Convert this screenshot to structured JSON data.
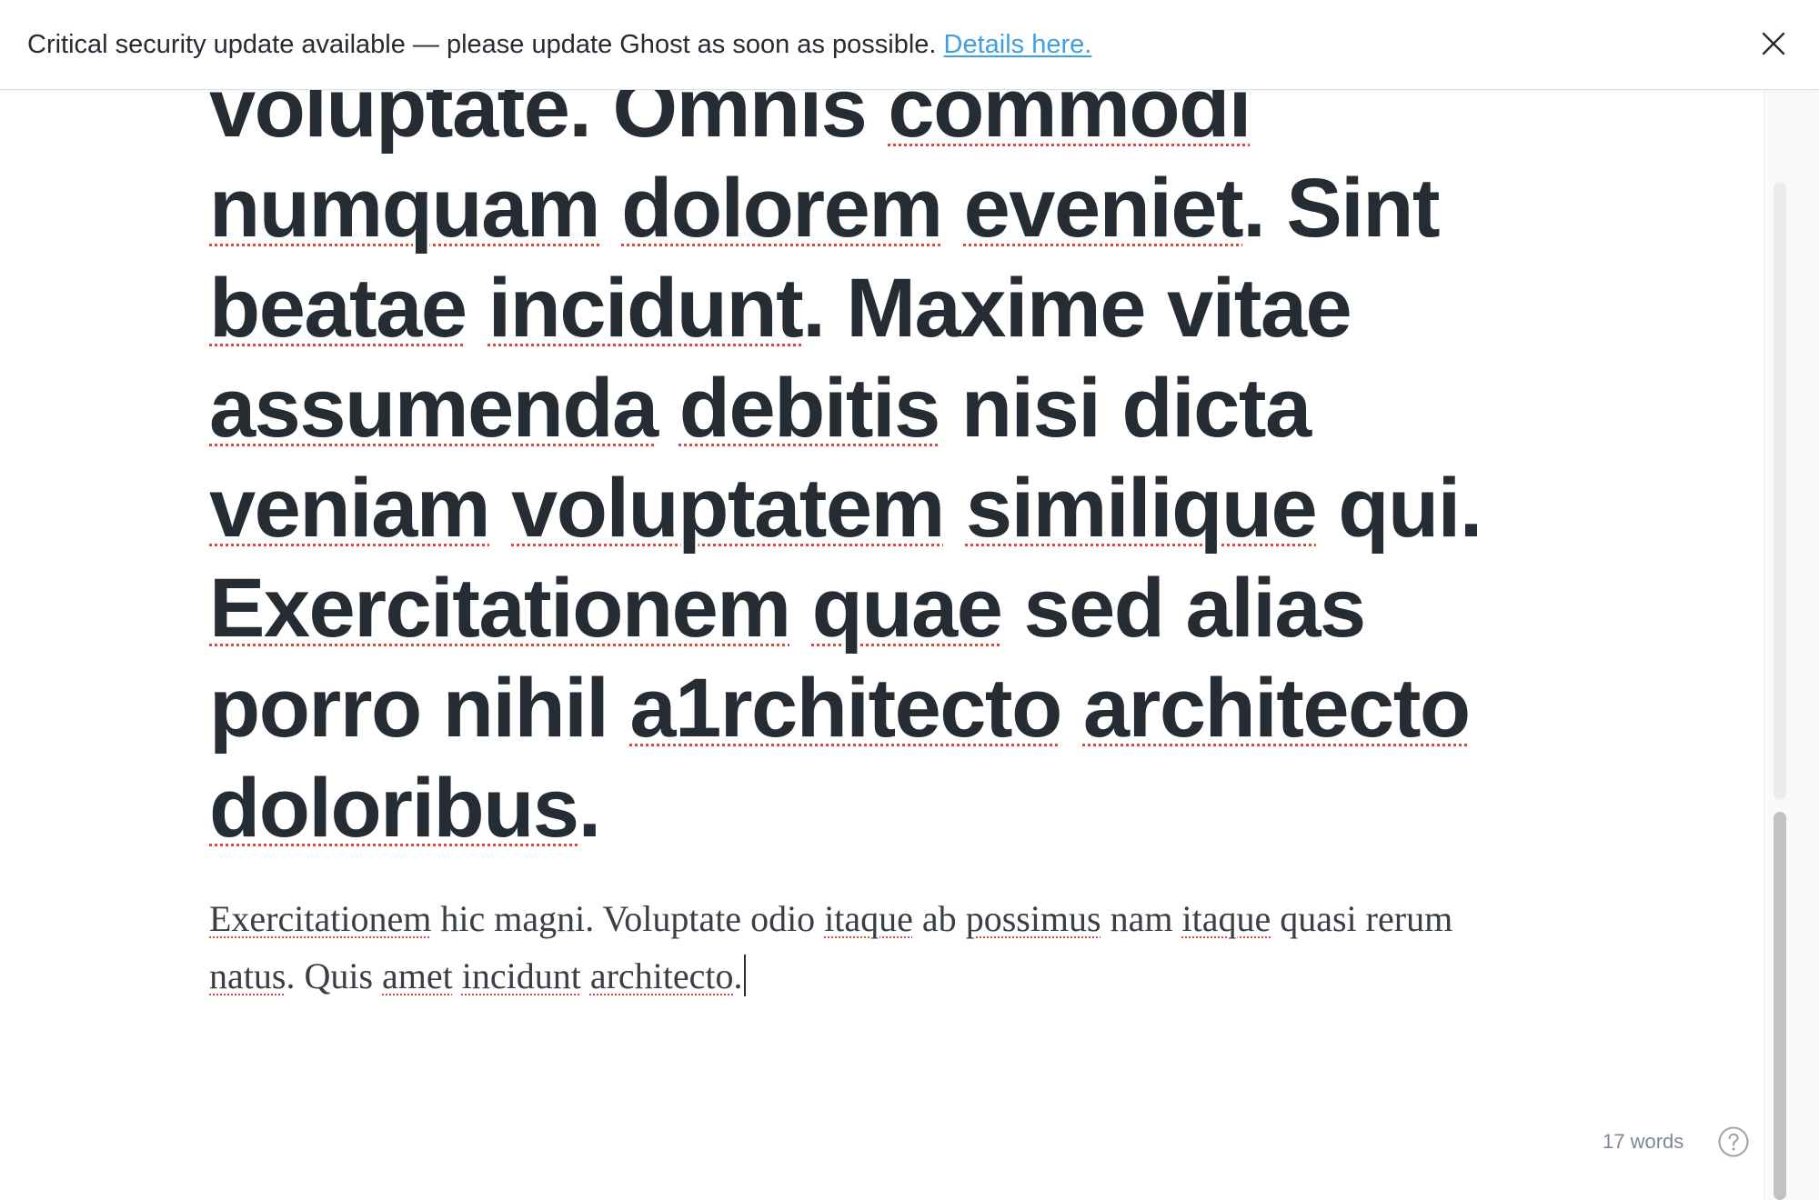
{
  "notice": {
    "message": "Critical security update available — please update Ghost as soon as possible. ",
    "link_label": "Details here.",
    "close_icon": "close-icon"
  },
  "editor": {
    "title_words": [
      {
        "text": "voluptate.",
        "misspelled": false
      },
      {
        "text": "Omnis",
        "misspelled": false
      },
      {
        "text": "commodi",
        "misspelled": true
      },
      {
        "text": "numquam",
        "misspelled": true
      },
      {
        "text": "dolorem",
        "misspelled": true
      },
      {
        "text": "eveniet",
        "misspelled": true,
        "suffix": "."
      },
      {
        "text": "Sint",
        "misspelled": false
      },
      {
        "text": "beatae",
        "misspelled": true
      },
      {
        "text": "incidunt",
        "misspelled": true,
        "suffix": "."
      },
      {
        "text": "Maxime",
        "misspelled": false
      },
      {
        "text": "vitae",
        "misspelled": false
      },
      {
        "text": "assumenda",
        "misspelled": true
      },
      {
        "text": "debitis",
        "misspelled": true
      },
      {
        "text": "nisi",
        "misspelled": false
      },
      {
        "text": "dicta",
        "misspelled": false
      },
      {
        "text": "veniam",
        "misspelled": true
      },
      {
        "text": "voluptatem",
        "misspelled": true
      },
      {
        "text": "similique",
        "misspelled": true
      },
      {
        "text": "qui.",
        "misspelled": false
      },
      {
        "text": "Exercitationem",
        "misspelled": true
      },
      {
        "text": "quae",
        "misspelled": true
      },
      {
        "text": "sed",
        "misspelled": false
      },
      {
        "text": "alias",
        "misspelled": false
      },
      {
        "text": "porro",
        "misspelled": false
      },
      {
        "text": "nihil",
        "misspelled": false
      },
      {
        "text": "a1rchitecto",
        "misspelled": true
      },
      {
        "text": "architecto",
        "misspelled": true
      },
      {
        "text": "doloribus",
        "misspelled": true,
        "suffix": "."
      }
    ],
    "body_words": [
      {
        "text": "Exercitationem",
        "misspelled": true
      },
      {
        "text": "hic",
        "misspelled": false
      },
      {
        "text": "magni.",
        "misspelled": false
      },
      {
        "text": "Voluptate",
        "misspelled": false
      },
      {
        "text": "odio",
        "misspelled": false
      },
      {
        "text": "itaque",
        "misspelled": true
      },
      {
        "text": "ab",
        "misspelled": false
      },
      {
        "text": "possimus",
        "misspelled": true
      },
      {
        "text": "nam",
        "misspelled": false
      },
      {
        "text": "itaque",
        "misspelled": true
      },
      {
        "text": "quasi",
        "misspelled": false
      },
      {
        "text": "rerum",
        "misspelled": false
      },
      {
        "text": "natus",
        "misspelled": true,
        "suffix": "."
      },
      {
        "text": "Quis",
        "misspelled": false
      },
      {
        "text": "amet",
        "misspelled": true
      },
      {
        "text": "incidunt",
        "misspelled": true
      },
      {
        "text": "architecto",
        "misspelled": true,
        "suffix": "."
      }
    ],
    "spellcheck_color": "#e2463c",
    "text_color": "#262c33"
  },
  "status": {
    "word_count": "17 words",
    "help_icon": "help-circle-icon"
  },
  "colors": {
    "link": "#3f9fe3",
    "muted": "#7d8791",
    "scroll_thumb": "#c2c2c2"
  }
}
